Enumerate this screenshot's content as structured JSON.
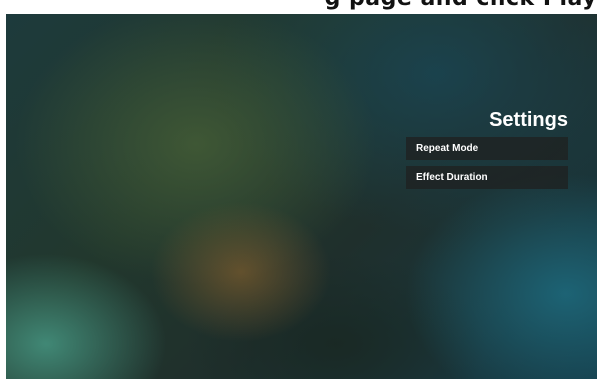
{
  "header_strip": {
    "text": "g page and click Play"
  },
  "settings": {
    "title": "Settings",
    "items": [
      {
        "label": "Repeat Mode"
      },
      {
        "label": "Effect Duration"
      }
    ]
  }
}
